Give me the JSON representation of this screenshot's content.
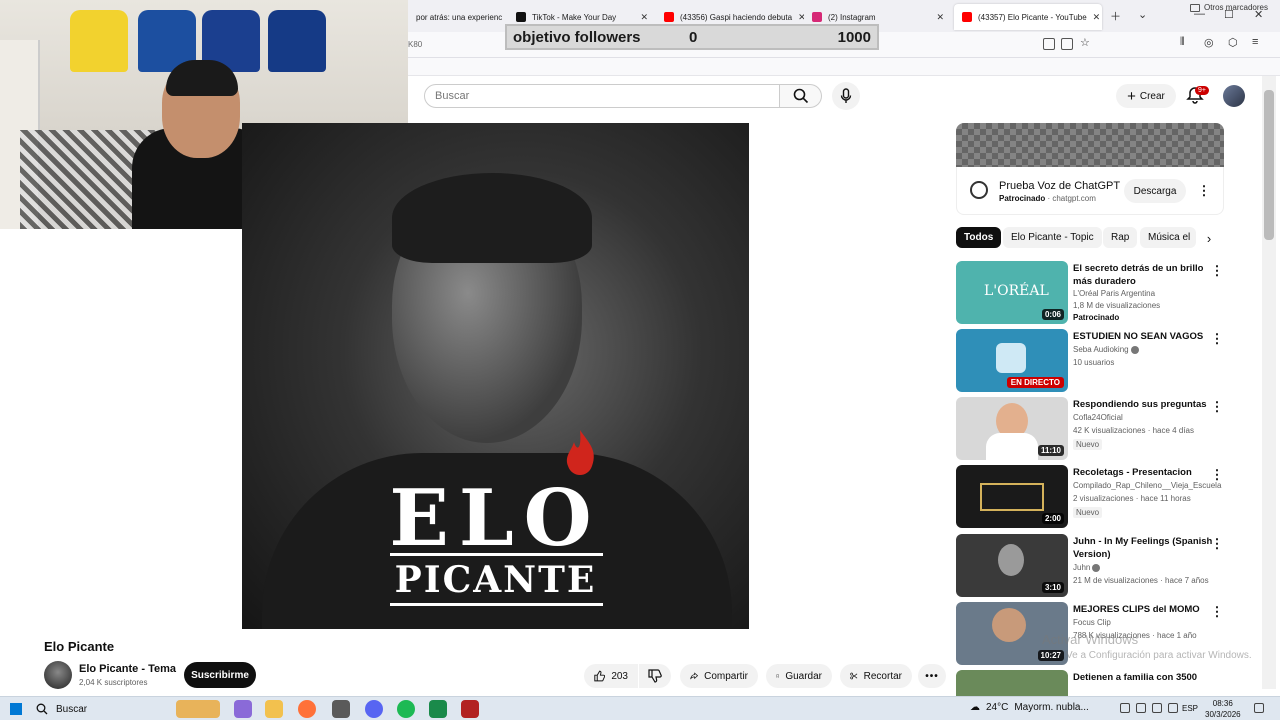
{
  "browser": {
    "tabs": [
      {
        "label": "por atrás: una experienc",
        "color": "#555555"
      },
      {
        "label": "TikTok - Make Your Day",
        "color": "#111111"
      },
      {
        "label": "(43356) Gaspi haciendo debuta",
        "color": "#ff0000"
      },
      {
        "label": "(2) Instagram",
        "color": "#d62976"
      },
      {
        "label": "(43357) Elo Picante - YouTube",
        "color": "#ff0000"
      }
    ],
    "url_fragment": "K80",
    "bookmarks_folder": "Otros marcadores"
  },
  "overlay": {
    "label": "objetivo followers",
    "current": "0",
    "goal": "1000"
  },
  "youtube": {
    "search_placeholder": "Buscar",
    "create_label": "Crear",
    "notifications_badge": "9+",
    "video": {
      "art_title": "ELO",
      "art_subtitle": "PICANTE",
      "title": "Elo Picante",
      "channel": "Elo Picante - Tema",
      "subscribers": "2,04 K suscriptores",
      "subscribe_label": "Suscribirme",
      "likes": "203",
      "share_label": "Compartir",
      "save_label": "Guardar",
      "clip_label": "Recortar"
    },
    "ad": {
      "title": "Prueba Voz de ChatGPT",
      "sponsored": "Patrocinado",
      "domain": "chatgpt.com",
      "cta": "Descarga"
    },
    "chips": [
      "Todos",
      "Elo Picante - Topic",
      "Rap",
      "Música el"
    ],
    "recommendations": [
      {
        "title": "El secreto detrás de un brillo más duradero",
        "channel": "L'Oréal Paris Argentina",
        "meta": "1,8 M de visualizaciones",
        "extra": "Patrocinado",
        "duration": "0:06",
        "thumb": "#4fb3ad"
      },
      {
        "title": "ESTUDIEN NO SEAN VAGOS",
        "channel": "Seba Audioking",
        "meta": "10 usuarios",
        "live": "EN DIRECTO",
        "thumb": "#2f8fb8"
      },
      {
        "title": "Respondiendo sus preguntas",
        "channel": "Cofla24Oficial",
        "meta": "42 K visualizaciones · hace 4 días",
        "badge": "Nuevo",
        "duration": "11:10",
        "thumb": "#d8d8d8"
      },
      {
        "title": "Recoletags - Presentacion",
        "channel": "Compilado_Rap_Chileno__Vieja_Escuela",
        "meta": "2 visualizaciones · hace 11 horas",
        "badge": "Nuevo",
        "duration": "2:00",
        "thumb": "#1a1a1a"
      },
      {
        "title": "Juhn - In My Feelings (Spanish Version)",
        "channel": "Juhn",
        "meta": "21 M de visualizaciones · hace 7 años",
        "duration": "3:10",
        "thumb": "#3a3a3a"
      },
      {
        "title": "MEJORES CLIPS del MOMO",
        "channel": "Focus Clip",
        "meta": "788 K visualizaciones · hace 1 año",
        "duration": "10:27",
        "thumb": "#6a7a8a"
      },
      {
        "title": "Detienen a familia con 3500",
        "channel": "",
        "meta": "",
        "thumb": "#6a8a5a"
      }
    ],
    "watermark_line1": "Activar Windows",
    "watermark_line2": "Ve a Configuración para activar Windows."
  },
  "taskbar": {
    "search_label": "Buscar",
    "temperature": "24°C",
    "weather": "Mayorm. nubla...",
    "language": "ESP",
    "time": "08:36",
    "date": "30/3/2026"
  }
}
